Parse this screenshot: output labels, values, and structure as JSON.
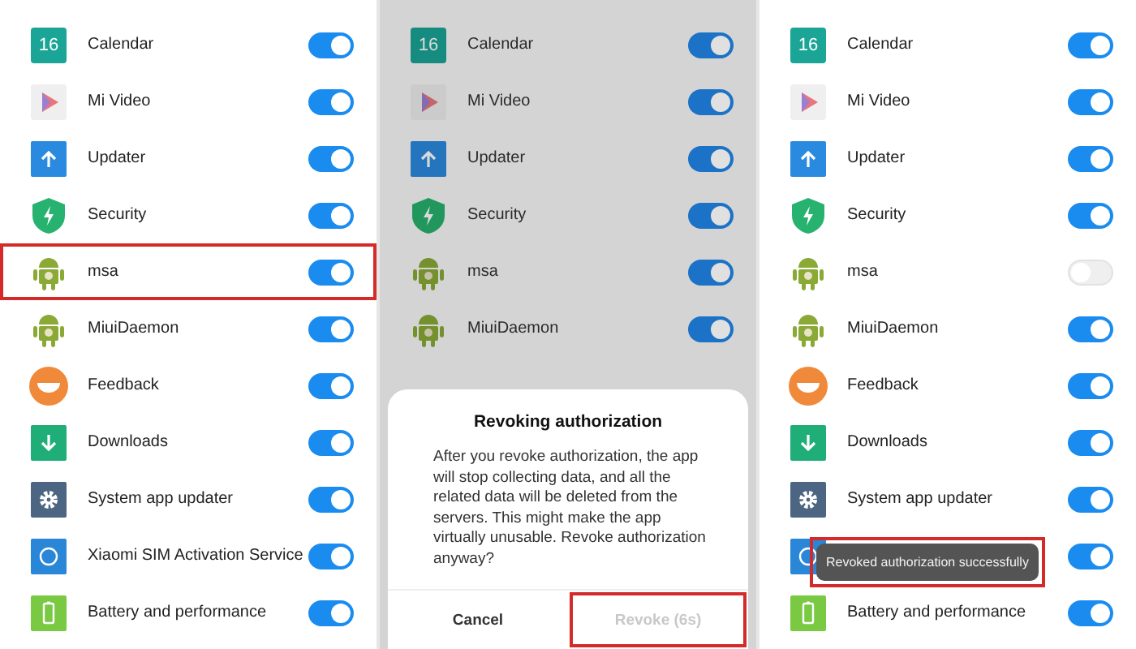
{
  "panels": [
    {
      "dimmed": false,
      "rows": [
        {
          "kind": "calendar",
          "icon_text": "16",
          "name": "Calendar",
          "on": true,
          "highlighted": false
        },
        {
          "kind": "video",
          "name": "Mi Video",
          "on": true,
          "highlighted": false
        },
        {
          "kind": "updater",
          "name": "Updater",
          "on": true,
          "highlighted": false
        },
        {
          "kind": "security",
          "name": "Security",
          "on": true,
          "highlighted": false
        },
        {
          "kind": "android",
          "name": "msa",
          "on": true,
          "highlighted": true
        },
        {
          "kind": "android",
          "name": "MiuiDaemon",
          "on": true,
          "highlighted": false
        },
        {
          "kind": "feedback",
          "name": "Feedback",
          "on": true,
          "highlighted": false
        },
        {
          "kind": "download",
          "name": "Downloads",
          "on": true,
          "highlighted": false
        },
        {
          "kind": "gear",
          "name": "System app updater",
          "on": true,
          "highlighted": false
        },
        {
          "kind": "sim",
          "name": "Xiaomi SIM Activation Service",
          "on": true,
          "highlighted": false
        },
        {
          "kind": "battery",
          "name": "Battery and performance",
          "on": true,
          "highlighted": false
        }
      ]
    },
    {
      "dimmed": true,
      "rows": [
        {
          "kind": "calendar",
          "icon_text": "16",
          "name": "Calendar",
          "on": true,
          "highlighted": false
        },
        {
          "kind": "video",
          "name": "Mi Video",
          "on": true,
          "highlighted": false
        },
        {
          "kind": "updater",
          "name": "Updater",
          "on": true,
          "highlighted": false
        },
        {
          "kind": "security",
          "name": "Security",
          "on": true,
          "highlighted": false
        },
        {
          "kind": "android",
          "name": "msa",
          "on": true,
          "highlighted": false
        },
        {
          "kind": "android",
          "name": "MiuiDaemon",
          "on": true,
          "highlighted": false
        }
      ],
      "dialog": {
        "title": "Revoking authorization",
        "message": "After you revoke authorization, the app will stop collecting data, and all the related data will be deleted from the servers. This might make the app virtually unusable. Revoke authorization anyway?",
        "buttons": [
          {
            "label": "Cancel",
            "disabled": false,
            "highlighted": false
          },
          {
            "label": "Revoke (6s)",
            "disabled": true,
            "highlighted": true
          }
        ]
      }
    },
    {
      "dimmed": false,
      "rows": [
        {
          "kind": "calendar",
          "icon_text": "16",
          "name": "Calendar",
          "on": true,
          "highlighted": false
        },
        {
          "kind": "video",
          "name": "Mi Video",
          "on": true,
          "highlighted": false
        },
        {
          "kind": "updater",
          "name": "Updater",
          "on": true,
          "highlighted": false
        },
        {
          "kind": "security",
          "name": "Security",
          "on": true,
          "highlighted": false
        },
        {
          "kind": "android",
          "name": "msa",
          "on": false,
          "highlighted": false
        },
        {
          "kind": "android",
          "name": "MiuiDaemon",
          "on": true,
          "highlighted": false
        },
        {
          "kind": "feedback",
          "name": "Feedback",
          "on": true,
          "highlighted": false
        },
        {
          "kind": "download",
          "name": "Downloads",
          "on": true,
          "highlighted": false
        },
        {
          "kind": "gear",
          "name": "System app updater",
          "on": true,
          "highlighted": false
        },
        {
          "kind": "sim",
          "on": true,
          "highlighted": false
        },
        {
          "kind": "battery",
          "name": "Battery and performance",
          "on": true,
          "highlighted": false
        }
      ],
      "toast": {
        "text": "Revoked authorization successfully",
        "highlighted": true
      }
    }
  ]
}
